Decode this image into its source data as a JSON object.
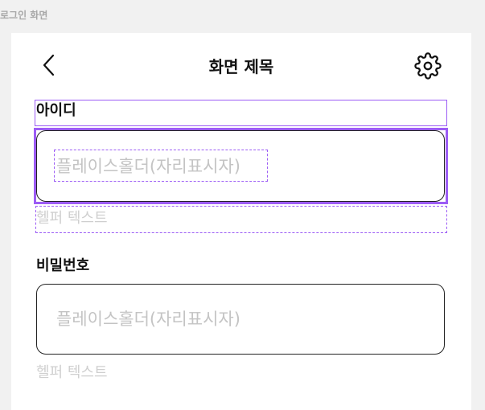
{
  "frame_label": "로그인 화면",
  "header": {
    "title": "화면 제목",
    "back_icon": "chevron-left-icon",
    "settings_icon": "gear-icon"
  },
  "form": {
    "id_field": {
      "label": "아이디",
      "placeholder": "플레이스홀더(자리표시자)",
      "value": "",
      "helper": "헬퍼 텍스트"
    },
    "password_field": {
      "label": "비밀번호",
      "placeholder": "플레이스홀더(자리표시자)",
      "value": "",
      "helper": "헬퍼 텍스트"
    }
  },
  "colors": {
    "selection": "#9c5cf5",
    "placeholder": "#c4c4c4",
    "helper": "#cfcfcf",
    "border": "#222222"
  }
}
